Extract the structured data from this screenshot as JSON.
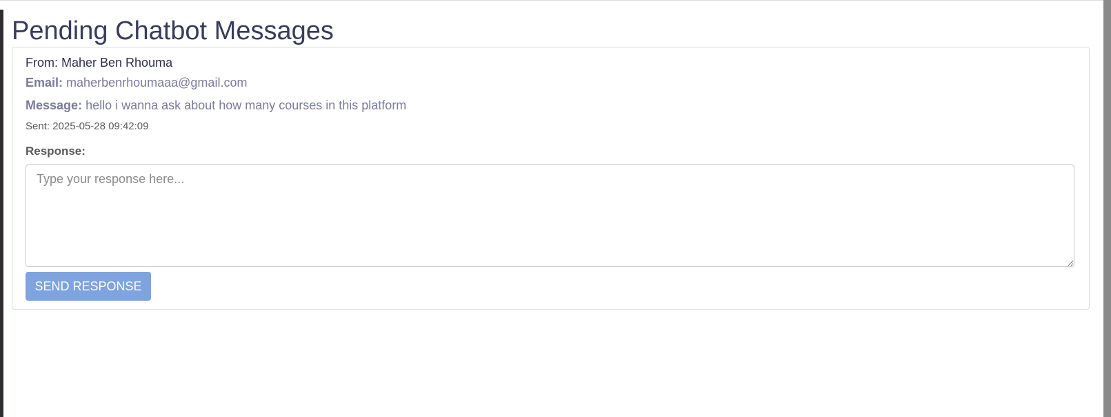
{
  "page": {
    "title": "Pending Chatbot Messages"
  },
  "message": {
    "from_prefix": "From: ",
    "from_name": "Maher Ben Rhouma",
    "email_label": "Email:",
    "email_value": "maherbenrhoumaaa@gmail.com",
    "message_label": "Message:",
    "message_value": "hello i wanna ask about how many courses in this platform",
    "sent_prefix": "Sent: ",
    "sent_value": "2025-05-28 09:42:09"
  },
  "response": {
    "label": "Response:",
    "placeholder": "Type your response here...",
    "value": "",
    "send_label": "SEND RESPONSE"
  },
  "colors": {
    "title": "#383c5c",
    "button_bg": "#7ea3de",
    "muted_text": "#7a7c9c",
    "card_border": "#dcdcdc"
  }
}
